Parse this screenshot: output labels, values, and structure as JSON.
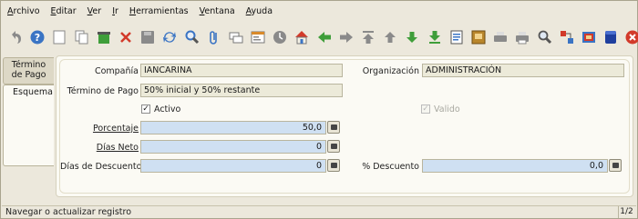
{
  "menu": {
    "items": [
      {
        "label": "Archivo"
      },
      {
        "label": "Editar"
      },
      {
        "label": "Ver"
      },
      {
        "label": "Ir"
      },
      {
        "label": "Herramientas"
      },
      {
        "label": "Ventana"
      },
      {
        "label": "Ayuda"
      }
    ]
  },
  "toolbar": {
    "icons": [
      "undo-icon",
      "help-icon",
      "new-record-icon",
      "copy-record-icon",
      "delete-icon",
      "delete-selection-icon",
      "save-icon",
      "refresh-icon",
      "find-icon",
      "attachment-icon",
      "chat-icon",
      "grid-toggle-icon",
      "history-icon",
      "home-icon",
      "back-icon",
      "forward-icon",
      "first-record-icon",
      "previous-record-icon",
      "next-record-icon",
      "last-record-icon",
      "report-icon",
      "archive-icon",
      "print-preview-icon",
      "print-icon",
      "zoom-across-icon",
      "request-icon",
      "product-info-icon",
      "workflow-icon",
      "exit-icon"
    ],
    "colors": {
      "blue": "#3a74c4",
      "green": "#3f9e3a",
      "red": "#d23a2a",
      "gray": "#8a8a8a",
      "dark": "#555555"
    }
  },
  "tabs": [
    {
      "label_line1": "Término",
      "label_line2": "de Pago"
    },
    {
      "label": "Esquema"
    }
  ],
  "form": {
    "compania": {
      "label": "Compañía",
      "value": "IANCARINA"
    },
    "organizacion": {
      "label": "Organización",
      "value": "ADMINISTRACIÓN"
    },
    "termino": {
      "label": "Término de Pago",
      "value": "50% inicial y 50% restante"
    },
    "activo": {
      "label": "Activo",
      "checked": true
    },
    "valido": {
      "label": "Valido",
      "checked": true
    },
    "porcentaje": {
      "label": "Porcentaje",
      "value": "50,0"
    },
    "dias_neto": {
      "label": "Días Neto",
      "value": "0"
    },
    "dias_descuento": {
      "label": "Días de Descuento",
      "value": "0"
    },
    "pct_descuento": {
      "label": "% Descuento",
      "value": "0,0"
    }
  },
  "status": {
    "text": "Navegar o actualizar registro",
    "page": "1/2"
  }
}
